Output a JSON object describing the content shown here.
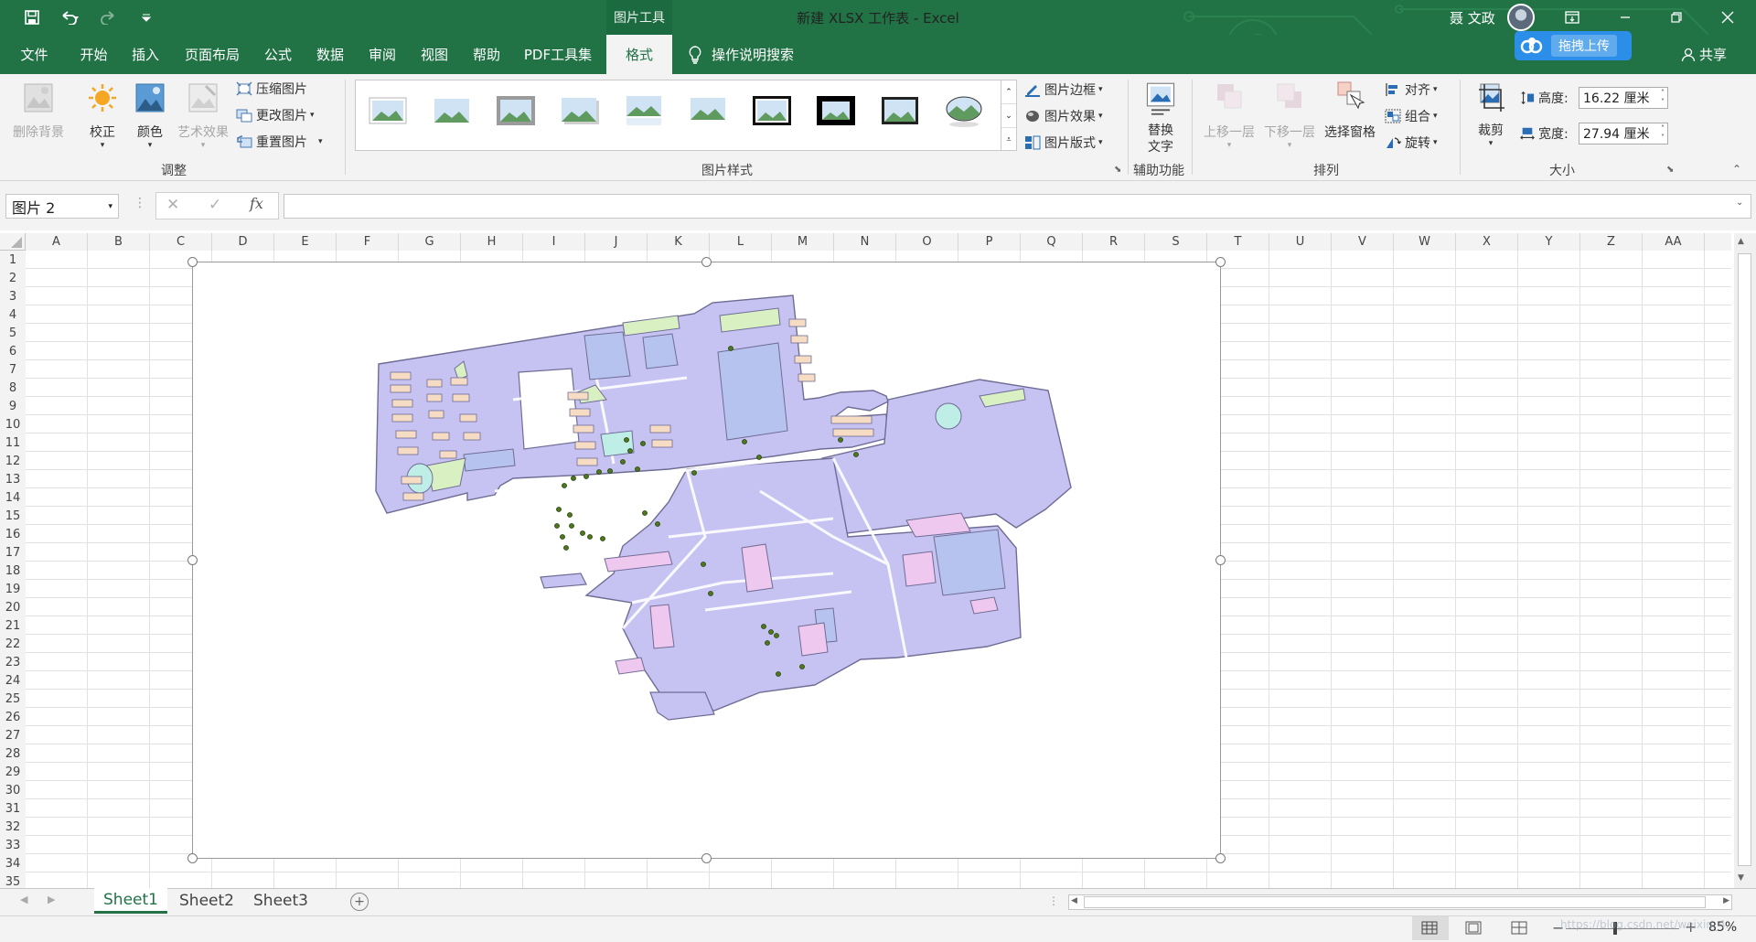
{
  "titlebar": {
    "context_group": "图片工具",
    "doc_title": "新建 XLSX 工作表  -  Excel",
    "user_name": "聂 文政",
    "upload_label": "拖拽上传",
    "icons": [
      "save-icon",
      "undo-icon",
      "redo-icon",
      "customize-qat-icon",
      "ribbon-display-icon",
      "minimize-icon",
      "restore-icon",
      "close-icon"
    ]
  },
  "tabs": {
    "file": "文件",
    "home": "开始",
    "insert": "插入",
    "layout": "页面布局",
    "formulas": "公式",
    "data": "数据",
    "review": "审阅",
    "view": "视图",
    "help": "帮助",
    "pdf": "PDF工具集",
    "format": "格式",
    "tell_me": "操作说明搜索",
    "share": "共享"
  },
  "ribbon": {
    "adjust": {
      "remove_bg": "删除背景",
      "corrections": "校正",
      "color": "颜色",
      "artistic": "艺术效果",
      "compress": "压缩图片",
      "change": "更改图片",
      "reset": "重置图片",
      "group_label": "调整"
    },
    "styles": {
      "border": "图片边框",
      "effects": "图片效果",
      "layout": "图片版式",
      "group_label": "图片样式"
    },
    "accessibility": {
      "alt_text_1": "替换",
      "alt_text_2": "文字",
      "group_label": "辅助功能"
    },
    "arrange": {
      "bring_forward": "上移一层",
      "send_backward": "下移一层",
      "selection_pane": "选择窗格",
      "align": "对齐",
      "group": "组合",
      "rotate": "旋转",
      "group_label": "排列"
    },
    "size": {
      "crop": "裁剪",
      "height_label": "高度:",
      "height_value": "16.22 厘米",
      "width_label": "宽度:",
      "width_value": "27.94 厘米",
      "group_label": "大小"
    }
  },
  "formula_bar": {
    "name_box": "图片 2",
    "fx": "fx",
    "cancel": "✕",
    "enter": "✓",
    "formula_value": ""
  },
  "columns": [
    "A",
    "B",
    "C",
    "D",
    "E",
    "F",
    "G",
    "H",
    "I",
    "J",
    "K",
    "L",
    "M",
    "N",
    "O",
    "P",
    "Q",
    "R",
    "S",
    "T",
    "U",
    "V",
    "W",
    "X",
    "Y",
    "Z",
    "AA"
  ],
  "rows": [
    "1",
    "2",
    "3",
    "4",
    "5",
    "6",
    "7",
    "8",
    "9",
    "10",
    "11",
    "12",
    "13",
    "14",
    "15",
    "16",
    "17",
    "18",
    "19",
    "20",
    "21",
    "22",
    "23",
    "24",
    "25",
    "26",
    "27",
    "28",
    "29",
    "30",
    "31",
    "32",
    "33",
    "34",
    "35"
  ],
  "sheets": [
    "Sheet1",
    "Sheet2",
    "Sheet3"
  ],
  "status": {
    "zoom": "85%",
    "watermark": "https://blog.csdn.net/weixin_4..."
  },
  "colors": {
    "excel_green": "#217346",
    "map_fill": "#c7c4f2",
    "map_stroke": "#6c6a92",
    "building": "#f5dcc2",
    "green_area": "#d9f0c2",
    "pink": "#eec8ee",
    "water": "#bfeee6",
    "points": "#4d7a1a"
  }
}
